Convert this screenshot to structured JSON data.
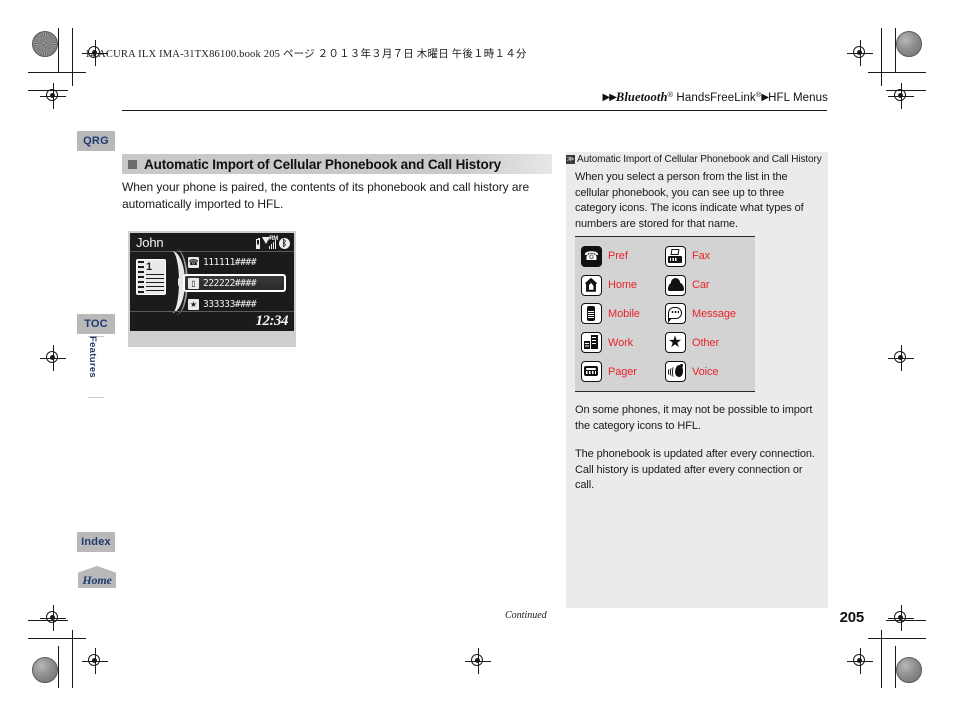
{
  "print": {
    "file_line": "14 ACURA ILX IMA-31TX86100.book   205 ページ   ２０１３年３月７日   木曜日   午後１時１４分"
  },
  "header": {
    "breadcrumb_arrow1": "▶▶",
    "breadcrumb_bluetooth": "Bluetooth",
    "breadcrumb_sup1": "®",
    "breadcrumb_handsfree": " HandsFreeLink",
    "breadcrumb_sup2": "®",
    "breadcrumb_arrow2": "▶",
    "breadcrumb_hfl": "HFL Menus"
  },
  "tabs": {
    "qrg": "QRG",
    "toc": "TOC",
    "features": "Features",
    "index": "Index",
    "home": "Home"
  },
  "main": {
    "section_title": "Automatic Import of Cellular Phonebook and Call History",
    "body": "When your phone is paired, the contents of its phonebook and call history are automatically imported to HFL."
  },
  "lcd": {
    "contact_name": "John",
    "status_roaming": "RM",
    "status_bluetooth": "ᛒ",
    "book_number": "1",
    "entries": [
      {
        "icon": "pref-icon",
        "glyph": "☎",
        "number": "111111####"
      },
      {
        "icon": "mobile-icon",
        "glyph": "▯",
        "number": "222222####"
      },
      {
        "icon": "other-icon",
        "glyph": "★",
        "number": "333333####"
      }
    ],
    "clock": "12:34"
  },
  "sidebar": {
    "title_glyph": "≫",
    "title": "Automatic Import of Cellular Phonebook and Call History",
    "para1": "When you select a person from the list in the cellular phonebook, you can see up to three category icons. The icons indicate what types of numbers are stored for that name.",
    "icon_table": [
      {
        "name": "pref-icon",
        "label": "Pref"
      },
      {
        "name": "fax-icon",
        "label": "Fax"
      },
      {
        "name": "home-icon",
        "label": "Home"
      },
      {
        "name": "car-icon",
        "label": "Car"
      },
      {
        "name": "mobile-icon",
        "label": "Mobile"
      },
      {
        "name": "message-icon",
        "label": "Message"
      },
      {
        "name": "work-icon",
        "label": "Work"
      },
      {
        "name": "other-icon",
        "label": "Other"
      },
      {
        "name": "pager-icon",
        "label": "Pager"
      },
      {
        "name": "voice-icon",
        "label": "Voice"
      }
    ],
    "para2": "On some phones, it may not be possible to import the category icons to HFL.",
    "para3": "The phonebook is updated after every connection. Call history is updated after every connection or call."
  },
  "footer": {
    "continued": "Continued",
    "page_number": "205"
  },
  "colors": {
    "accent_red": "#e8242a",
    "tab_blue": "#1f3a6e",
    "tab_gray": "#b9b9b9",
    "sidebar_bg": "#ebebeb",
    "icon_table_bg": "#d3d3d3"
  }
}
